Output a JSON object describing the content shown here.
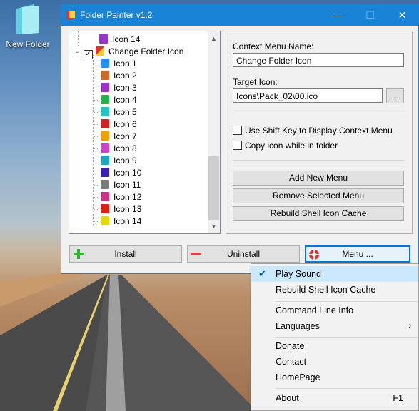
{
  "desktop": {
    "icon_label": "New Folder"
  },
  "window": {
    "title": "Folder Painter v1.2",
    "controls": {
      "minimize": "—",
      "maximize": "☐",
      "close": "✕"
    }
  },
  "tree": {
    "top_item": "Icon 14",
    "parent": "Change Folder Icon",
    "items": [
      {
        "label": "Icon 1",
        "color": "#1e90ff"
      },
      {
        "label": "Icon 2",
        "color": "#d2691e"
      },
      {
        "label": "Icon 3",
        "color": "#9932cc"
      },
      {
        "label": "Icon 4",
        "color": "#22b14c"
      },
      {
        "label": "Icon 5",
        "color": "#20c5c5"
      },
      {
        "label": "Icon 6",
        "color": "#d42020"
      },
      {
        "label": "Icon 7",
        "color": "#f0a000"
      },
      {
        "label": "Icon 8",
        "color": "#cc44cc"
      },
      {
        "label": "Icon 9",
        "color": "#1aa7c0"
      },
      {
        "label": "Icon 10",
        "color": "#3a1fc0"
      },
      {
        "label": "Icon 11",
        "color": "#7a7a7a"
      },
      {
        "label": "Icon 12",
        "color": "#d0308a"
      },
      {
        "label": "Icon 13",
        "color": "#e02010"
      },
      {
        "label": "Icon 14",
        "color": "#e8d800"
      }
    ]
  },
  "settings": {
    "context_menu_label": "Context Menu Name:",
    "context_menu_value": "Change Folder Icon",
    "target_icon_label": "Target Icon:",
    "target_icon_value": "Icons\\Pack_02\\00.ico",
    "browse_label": "...",
    "shift_key_label": "Use Shift Key to Display Context Menu",
    "copy_icon_label": "Copy icon while in folder",
    "add_menu": "Add New Menu",
    "remove_menu": "Remove Selected Menu",
    "rebuild_cache": "Rebuild Shell Icon Cache"
  },
  "actions": {
    "install": "Install",
    "uninstall": "Uninstall",
    "menu": "Menu ..."
  },
  "context_menu": {
    "play_sound": "Play Sound",
    "rebuild_cache": "Rebuild Shell Icon Cache",
    "command_line": "Command Line Info",
    "languages": "Languages",
    "donate": "Donate",
    "contact": "Contact",
    "homepage": "HomePage",
    "about": "About",
    "about_shortcut": "F1"
  },
  "colors": {
    "accent": "#1883d7",
    "install_icon": "#2fb52f",
    "uninstall_icon": "#e04040"
  }
}
